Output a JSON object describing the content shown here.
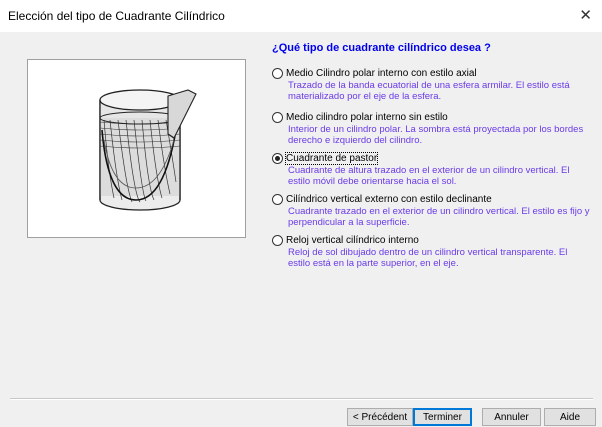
{
  "window": {
    "title": "Elección del tipo de Cuadrante Cilíndrico",
    "close_glyph": "✕"
  },
  "question": "¿Qué tipo de cuadrante cilíndrico desea ?",
  "options": [
    {
      "label": "Medio Cilindro polar interno con estilo axial",
      "description": "Trazado de la banda ecuatorial de una esfera armilar. El estilo está materializado por el eje de la esfera.",
      "selected": false
    },
    {
      "label": "Medio cilindro polar interno sin estilo",
      "description": "Interior de un cilindro polar. La sombra está proyectada por los bordes derecho e izquierdo del cilindro.",
      "selected": false
    },
    {
      "label": "Cuadrante de pastor",
      "description": "Cuadrante de altura trazado en el exterior de un cilindro vertical. El estilo móvil debe orientarse hacia el sol.",
      "selected": true
    },
    {
      "label": "Cilíndrico vertical externo con estilo declinante",
      "description": "Cuadrante trazado en el exterior de un cilindro vertical. El estilo es fijo y perpendicular a la superficie.",
      "selected": false
    },
    {
      "label": "Reloj vertical cilíndrico interno",
      "description": "Reloj de sol dibujado dentro de un cilindro vertical transparente. El estilo está en la parte superior, en el eje.",
      "selected": false
    }
  ],
  "buttons": {
    "previous": "< Précédent",
    "finish": "Terminer",
    "cancel": "Annuler",
    "help": "Aide"
  },
  "colors": {
    "question": "#0000ee",
    "description": "#6a3be8",
    "client_bg": "#f0f0f0"
  }
}
